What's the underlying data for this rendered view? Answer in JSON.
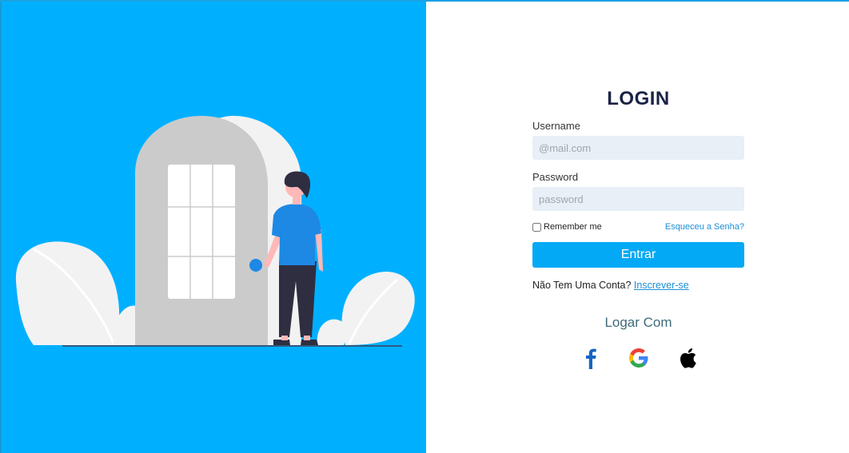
{
  "form": {
    "title": "LOGIN",
    "username_label": "Username",
    "username_placeholder": "@mail.com",
    "username_value": "",
    "password_label": "Password",
    "password_placeholder": "password",
    "password_value": "",
    "remember_label": "Remember me",
    "remember_checked": false,
    "forgot_link": "Esqueceu a Senha?",
    "submit_label": "Entrar",
    "no_account_text": "Não Tem Uma Conta?",
    "signup_link": "Inscrever-se",
    "social_heading": "Logar Com",
    "social_icons": [
      "facebook-icon",
      "google-icon",
      "apple-icon"
    ]
  },
  "colors": {
    "left_panel_bg": "#00b0ff",
    "button_bg": "#03a9f4",
    "title": "#1b2346",
    "link": "#1a8fd6",
    "input_bg": "#e8eff6"
  }
}
